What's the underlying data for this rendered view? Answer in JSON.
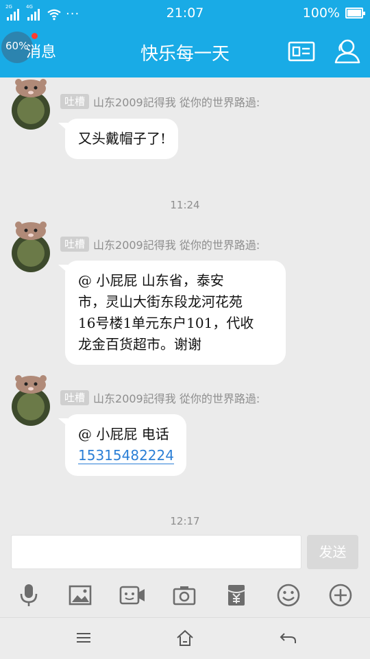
{
  "status_bar": {
    "sim1_label": "2G",
    "sim2_label": "4G",
    "more": "···",
    "time": "21:07",
    "battery": "100%"
  },
  "header": {
    "back_badge": "60%",
    "back_label": "消息",
    "title": "快乐每一天",
    "profile_card_icon": "id-card-icon",
    "members_icon": "person-icon"
  },
  "messages": [
    {
      "tag": "吐槽",
      "sender": "山东2009記得我 從你的世界路過:",
      "lines": [
        "又头戴帽子了!"
      ]
    },
    {
      "time": "11:24"
    },
    {
      "tag": "吐槽",
      "sender": "山东2009記得我 從你的世界路過:",
      "lines": [
        "@  小屁屁  山东省，泰安",
        "市，灵山大街东段龙河花苑",
        "16号楼1单元东户101，代收",
        "龙金百货超市。谢谢"
      ]
    },
    {
      "tag": "吐槽",
      "sender": "山东2009記得我 從你的世界路過:",
      "lines": [
        "@  小屁屁  电话"
      ],
      "phone": "15315482224"
    },
    {
      "time": "12:17"
    }
  ],
  "input": {
    "placeholder": "",
    "send_label": "发送"
  },
  "toolbar": [
    "microphone-icon",
    "image-icon",
    "video-icon",
    "camera-icon",
    "red-packet-icon",
    "emoji-icon",
    "plus-icon"
  ],
  "nav": [
    "menu-icon",
    "home-icon",
    "back-icon"
  ],
  "colors": {
    "header": "#19abe6",
    "background": "#ebebeb",
    "bubble": "#ffffff",
    "link": "#2b7fd6",
    "tag_bg": "#cfcfcf",
    "badge_dot": "#ff3b30"
  }
}
